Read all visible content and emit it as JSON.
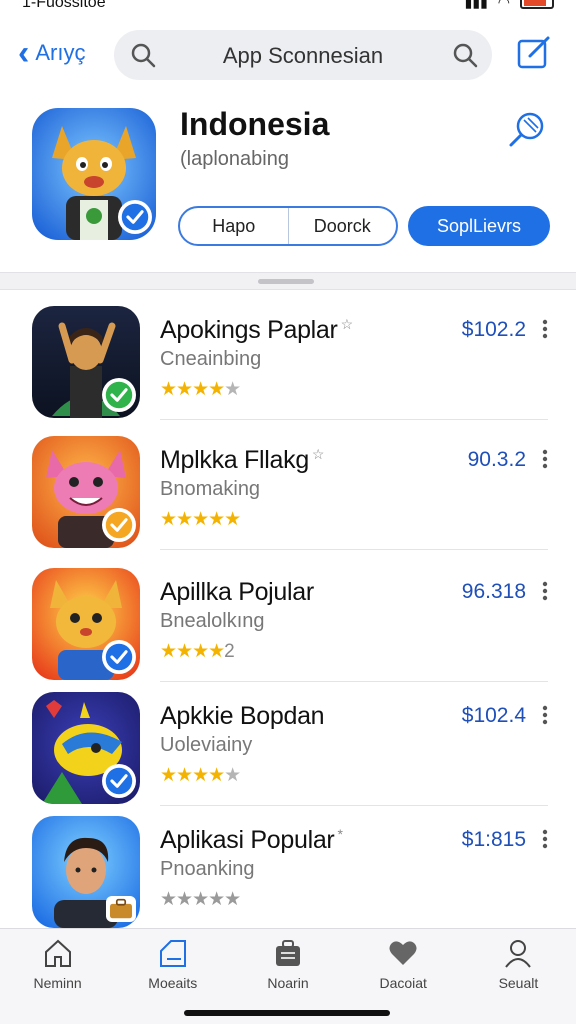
{
  "status_bar": {
    "carrier": "1-Fuossltoe"
  },
  "nav": {
    "back_label": "Arıyç",
    "search_text": "App Sconnesian"
  },
  "hero": {
    "title": "Indonesia",
    "subtitle": "(laplonabing",
    "segment_left": "Hapo",
    "segment_right": "Doorck",
    "primary_button": "SoplLievrs"
  },
  "apps": [
    {
      "title": "Apokings Paplar",
      "has_star_mark": true,
      "subtitle": "Cneainbing",
      "rating_stars": "★★★★",
      "rating_rest": "★",
      "price": "$102.2"
    },
    {
      "title": "Mplkka Fllakg",
      "has_star_mark": true,
      "subtitle": "Bnomaking",
      "rating_stars": "★★★★★",
      "rating_rest": "",
      "price": "90.3.2"
    },
    {
      "title": "Apillka Pojular",
      "has_star_mark": false,
      "subtitle": "Bnealolkıng",
      "rating_stars": "★★★★",
      "rating_rest": "2",
      "price": "96.318"
    },
    {
      "title": "Apkkie Bopdan",
      "has_star_mark": false,
      "subtitle": "Uoleviainy",
      "rating_stars": "★★★★",
      "rating_rest": "★",
      "price": "$102.4"
    },
    {
      "title": "Aplikasi Popular",
      "has_star_mark": true,
      "subtitle": "Pnoanking",
      "rating_stars": "",
      "rating_rest": "★★★★★",
      "price": "$1:815"
    }
  ],
  "tabs": [
    {
      "label": "Neminn",
      "icon": "home-icon"
    },
    {
      "label": "Moeaits",
      "icon": "tag-icon"
    },
    {
      "label": "Noarin",
      "icon": "briefcase-icon"
    },
    {
      "label": "Dacoiat",
      "icon": "heart-icon"
    },
    {
      "label": "Seualt",
      "icon": "person-icon"
    }
  ],
  "colors": {
    "accent": "#1f6fe5",
    "price": "#1f4fb8",
    "star_filled": "#f5b301",
    "star_empty": "#b5b5b5"
  }
}
